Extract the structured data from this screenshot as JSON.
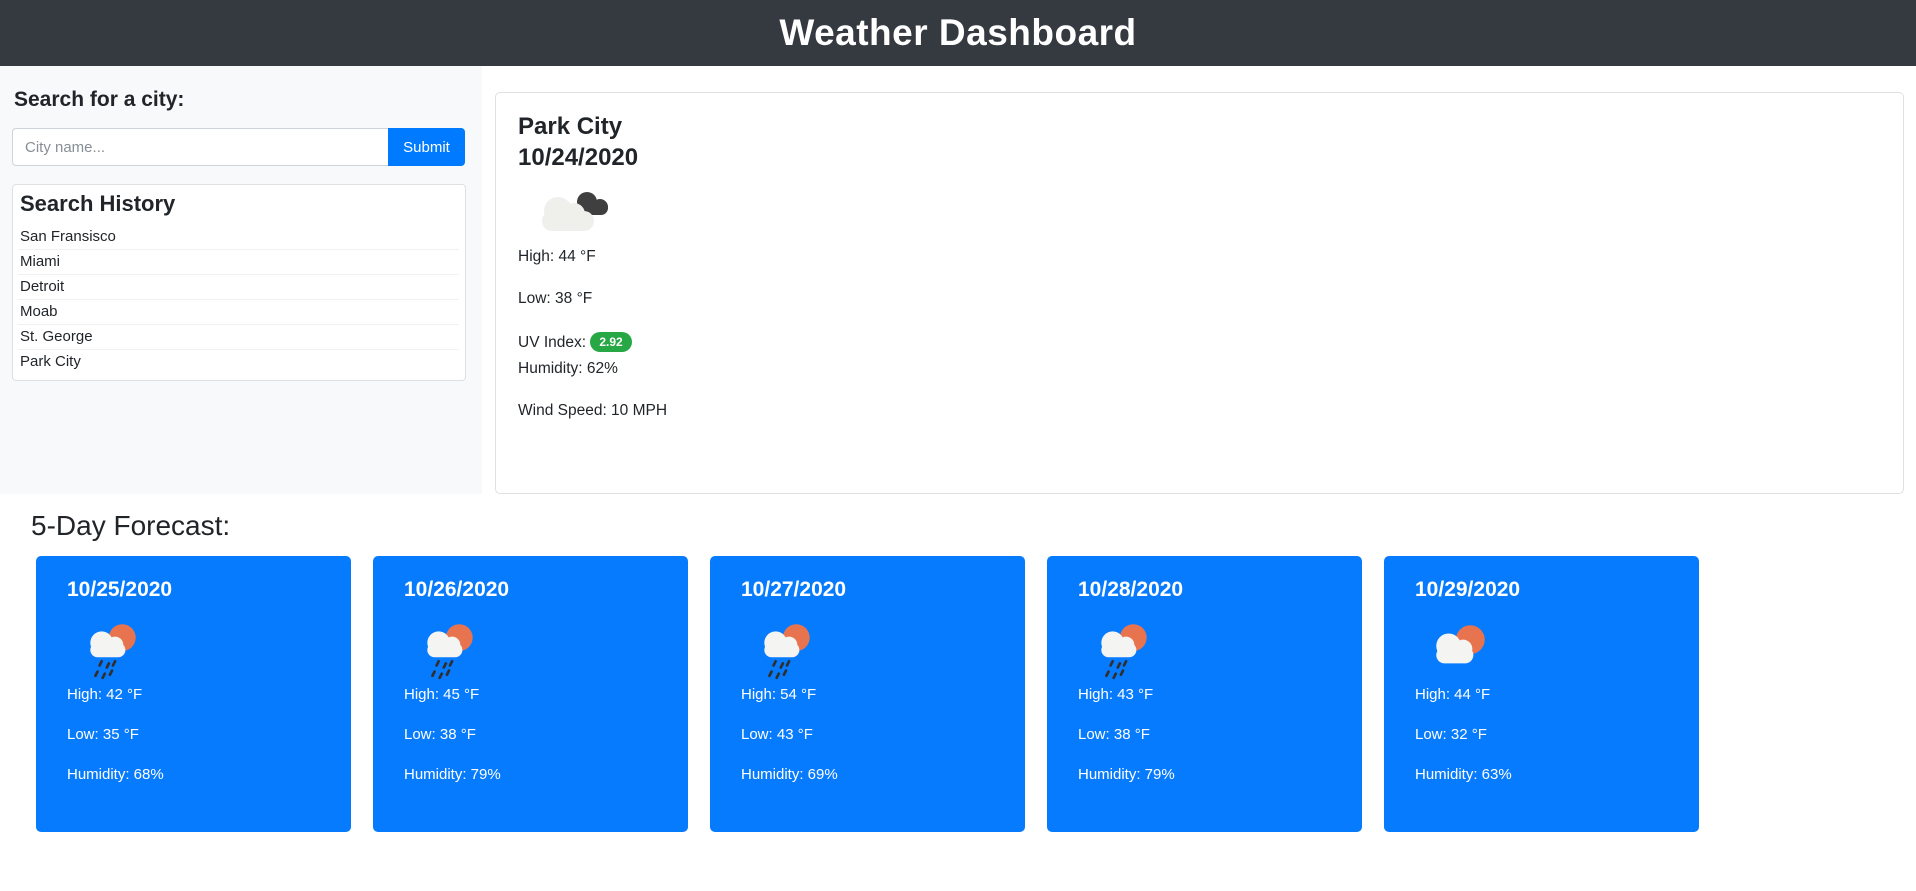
{
  "header": {
    "title": "Weather Dashboard"
  },
  "sidebar": {
    "search_label": "Search for a city:",
    "search_placeholder": "City name...",
    "submit_label": "Submit",
    "history_title": "Search History",
    "history_items": [
      "San Fransisco",
      "Miami",
      "Detroit",
      "Moab",
      "St. George",
      "Park City"
    ]
  },
  "current": {
    "city": "Park City",
    "date": "10/24/2020",
    "icon": "broken-clouds",
    "high": "High: 44 °F",
    "low": "Low: 38 °F",
    "uv_label": "UV Index:",
    "uv_value": "2.92",
    "humidity": "Humidity: 62%",
    "wind": "Wind Speed: 10 MPH"
  },
  "forecast": {
    "heading": "5-Day Forecast:",
    "days": [
      {
        "date": "10/25/2020",
        "icon": "rain",
        "high": "High: 42 °F",
        "low": "Low: 35 °F",
        "humidity": "Humidity: 68%"
      },
      {
        "date": "10/26/2020",
        "icon": "rain",
        "high": "High: 45 °F",
        "low": "Low: 38 °F",
        "humidity": "Humidity: 79%"
      },
      {
        "date": "10/27/2020",
        "icon": "rain",
        "high": "High: 54 °F",
        "low": "Low: 43 °F",
        "humidity": "Humidity: 69%"
      },
      {
        "date": "10/28/2020",
        "icon": "rain",
        "high": "High: 43 °F",
        "low": "Low: 38 °F",
        "humidity": "Humidity: 79%"
      },
      {
        "date": "10/29/2020",
        "icon": "sun-cloud",
        "high": "High: 44 °F",
        "low": "Low: 32 °F",
        "humidity": "Humidity: 63%"
      }
    ]
  },
  "colors": {
    "header_bg": "#343a40",
    "sidebar_bg": "#f8f9fa",
    "primary_blue": "#077bfe",
    "uv_badge_green": "#28a745",
    "sun_orange": "#e8744f"
  }
}
